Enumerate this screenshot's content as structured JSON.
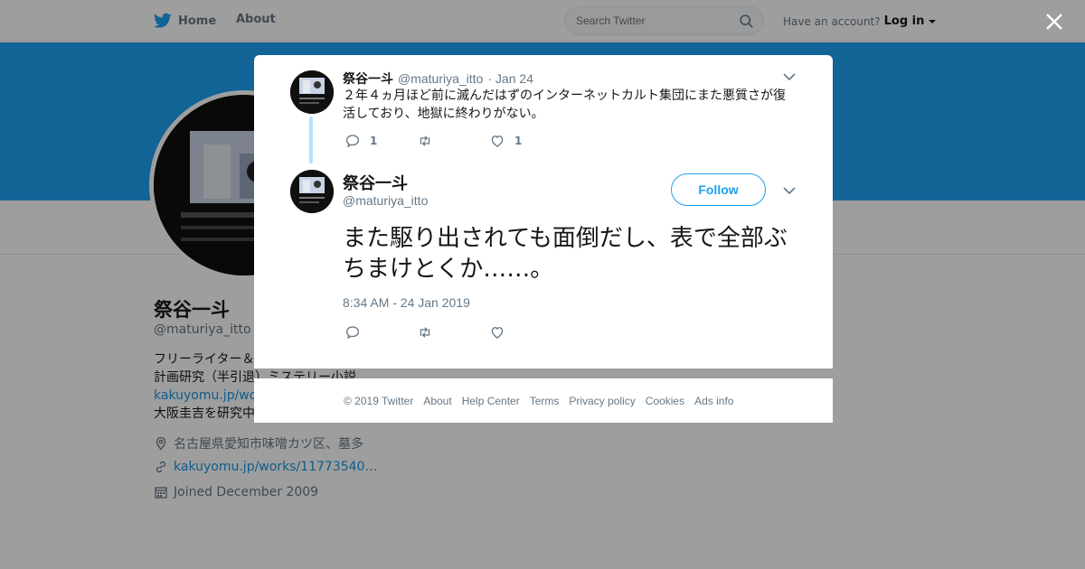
{
  "topbar": {
    "home_label": "Home",
    "about_label": "About",
    "search_placeholder": "Search Twitter",
    "account_text": "Have an account?",
    "login_label": "Log in"
  },
  "profile": {
    "name": "祭谷一斗",
    "handle": "@maturiya_itto",
    "bio_line1": "フリーライター＆",
    "bio_line2": "計画研究（半引退）ミステリー小説",
    "bio_link": "kakuyomu.jp/work",
    "bio_line3": "大阪圭吉を研究中",
    "location": "名古屋県愛知市味噌カツ区、墓多",
    "website": "kakuyomu.jp/works/11773540…",
    "joined": "Joined December 2009"
  },
  "parent_tweet": {
    "name": "祭谷一斗",
    "handle": "@maturiya_itto",
    "date": "· Jan 24",
    "text": "２年４ヵ月ほど前に滅んだはずのインターネットカルト集団にまた悪質さが復活しており、地獄に終わりがない。",
    "reply_count": "1",
    "retweet_count": "",
    "like_count": "1"
  },
  "main_tweet": {
    "name": "祭谷一斗",
    "handle": "@maturiya_itto",
    "follow_label": "Follow",
    "text": "また駆り出されても面倒だし、表で全部ぶちまけとくか……。",
    "timestamp": "8:34 AM - 24 Jan 2019"
  },
  "footer": {
    "links": [
      "© 2019 Twitter",
      "About",
      "Help Center",
      "Terms",
      "Privacy policy",
      "Cookies",
      "Ads info"
    ]
  },
  "colors": {
    "brand": "#1da1f2",
    "thread_line": "#b3e0ff",
    "muted_text": "#657786"
  }
}
